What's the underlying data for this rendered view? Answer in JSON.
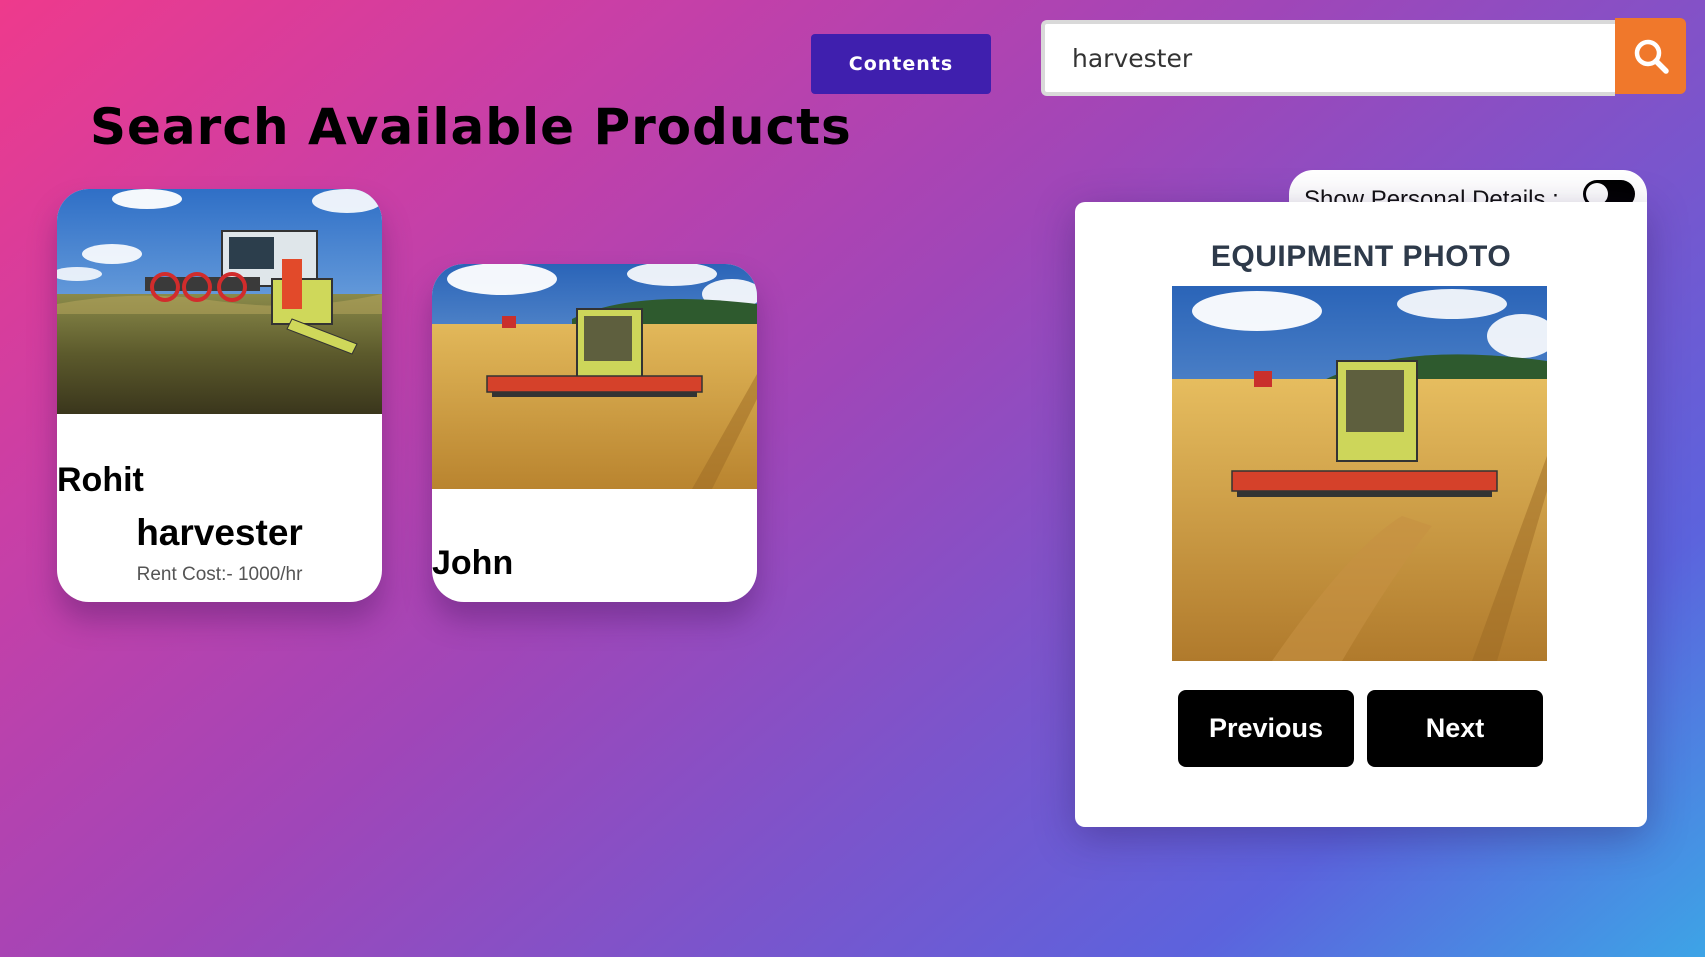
{
  "header": {
    "contents_label": "Contents",
    "search_value": "harvester",
    "search_icon": "search-icon"
  },
  "page_title": "Search Available Products",
  "products": [
    {
      "owner": "Rohit",
      "name": "harvester",
      "rent_cost": "Rent Cost:- 1000/hr",
      "photo": "combine-harvester-photo"
    },
    {
      "owner": "John",
      "photo": "combine-harvester-wheat-field-photo"
    }
  ],
  "detail_panel": {
    "toggle_label": "Show Personal Details :",
    "toggle_on": true,
    "title": "EQUIPMENT PHOTO",
    "photo": "combine-harvester-wheat-field-photo",
    "previous_label": "Previous",
    "next_label": "Next"
  },
  "colors": {
    "contents_button": "#3f1fae",
    "search_button": "#f0782b",
    "nav_buttons": "#000000"
  }
}
